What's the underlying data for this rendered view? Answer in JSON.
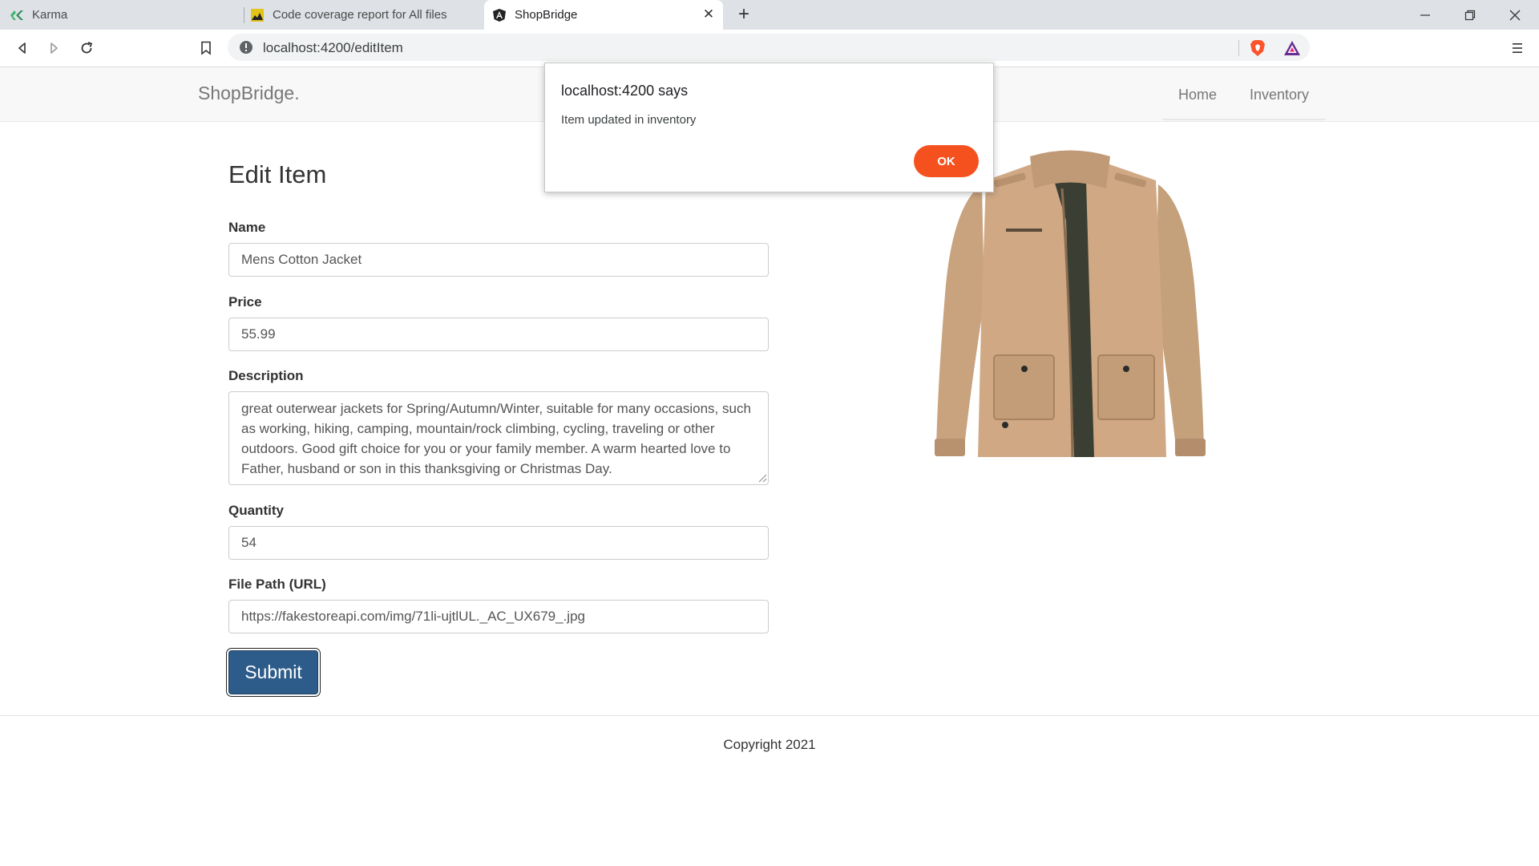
{
  "browser": {
    "tabs": [
      {
        "title": "Karma"
      },
      {
        "title": "Code coverage report for All files"
      },
      {
        "title": "ShopBridge"
      }
    ],
    "url": "localhost:4200/editItem"
  },
  "navbar": {
    "brand": "ShopBridge.",
    "links": [
      "Home",
      "Inventory"
    ]
  },
  "form": {
    "title": "Edit Item",
    "name_label": "Name",
    "name_value": "Mens Cotton Jacket",
    "price_label": "Price",
    "price_value": "55.99",
    "description_label": "Description",
    "description_value": "great outerwear jackets for Spring/Autumn/Winter, suitable for many occasions, such as working, hiking, camping, mountain/rock climbing, cycling, traveling or other outdoors. Good gift choice for you or your family member. A warm hearted love to Father, husband or son in this thanksgiving or Christmas Day.",
    "quantity_label": "Quantity",
    "quantity_value": "54",
    "filepath_label": "File Path (URL)",
    "filepath_value": "https://fakestoreapi.com/img/71li-ujtlUL._AC_UX679_.jpg",
    "submit_label": "Submit"
  },
  "footer": {
    "copyright": "Copyright 2021"
  },
  "alert": {
    "title": "localhost:4200 says",
    "message": "Item updated in inventory",
    "ok_label": "OK"
  },
  "colors": {
    "submit": "#2e5c8a",
    "ok_button": "#f4511e",
    "jacket": "#c9a27e"
  }
}
